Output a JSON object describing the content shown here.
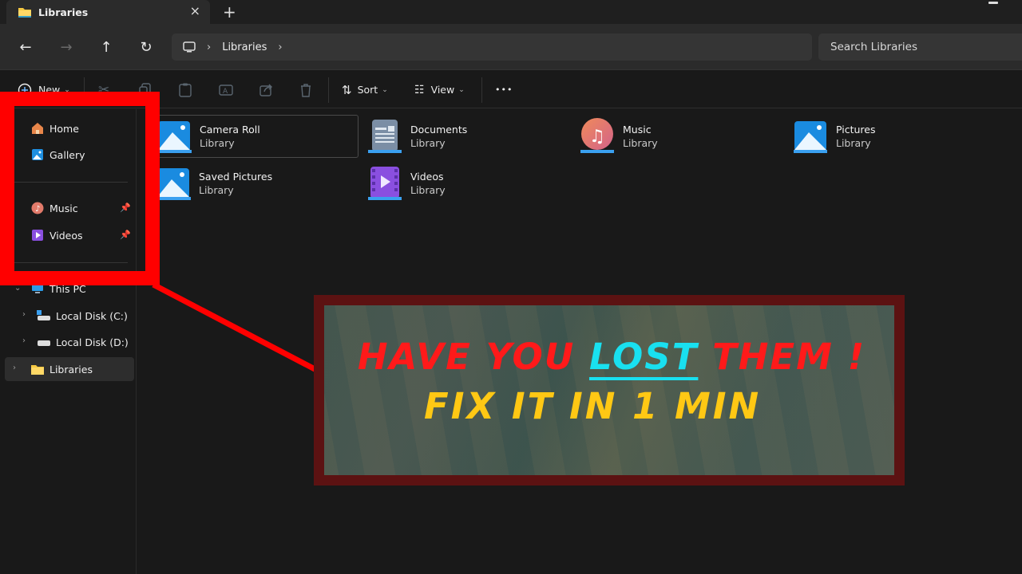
{
  "titlebar": {
    "tab_title": "Libraries",
    "tab_icon": "folder-icon",
    "close_icon": "×",
    "new_tab_icon": "+"
  },
  "navbar": {
    "back_icon": "←",
    "forward_icon": "→",
    "up_icon": "↑",
    "refresh_icon": "↻",
    "breadcrumb": [
      "This PC",
      "Libraries"
    ],
    "breadcrumb_sep": "›",
    "search_placeholder": "Search Libraries"
  },
  "toolbar": {
    "new_label": "New",
    "sort_label": "Sort",
    "view_label": "View",
    "more_label": "•••",
    "disabled_actions": [
      "cut",
      "copy",
      "paste",
      "rename",
      "share",
      "delete"
    ]
  },
  "sidebar": {
    "quick": [
      {
        "label": "Home",
        "icon": "home-icon"
      },
      {
        "label": "Gallery",
        "icon": "gallery-icon"
      }
    ],
    "pinned": [
      {
        "label": "Music",
        "icon": "music-icon",
        "pinned": true
      },
      {
        "label": "Videos",
        "icon": "videos-icon",
        "pinned": true
      }
    ],
    "tree": [
      {
        "label": "This PC",
        "icon": "pc-icon",
        "expanded": true
      },
      {
        "label": "Local Disk (C:)",
        "icon": "drive-icon"
      },
      {
        "label": "Local Disk (D:)",
        "icon": "drive-icon"
      },
      {
        "label": "Libraries",
        "icon": "folder-icon",
        "selected": true
      }
    ]
  },
  "libraries": [
    {
      "name": "Camera Roll",
      "type": "Library",
      "icon": "pictures-icon",
      "selected": true
    },
    {
      "name": "Documents",
      "type": "Library",
      "icon": "documents-icon"
    },
    {
      "name": "Music",
      "type": "Library",
      "icon": "music-icon"
    },
    {
      "name": "Pictures",
      "type": "Library",
      "icon": "pictures-icon"
    },
    {
      "name": "Saved Pictures",
      "type": "Library",
      "icon": "pictures-icon"
    },
    {
      "name": "Videos",
      "type": "Library",
      "icon": "videos-icon"
    }
  ],
  "overlay": {
    "line1_a": "HAVE YOU ",
    "line1_highlight": "LOST",
    "line1_b": " THEM !",
    "line2": "FIX IT IN 1 MIN",
    "colors": {
      "red": "#ff1a1a",
      "cyan": "#19e0f0",
      "yellow": "#ffc814",
      "frame": "#5c1212",
      "highlight_box": "#ff0000"
    }
  }
}
